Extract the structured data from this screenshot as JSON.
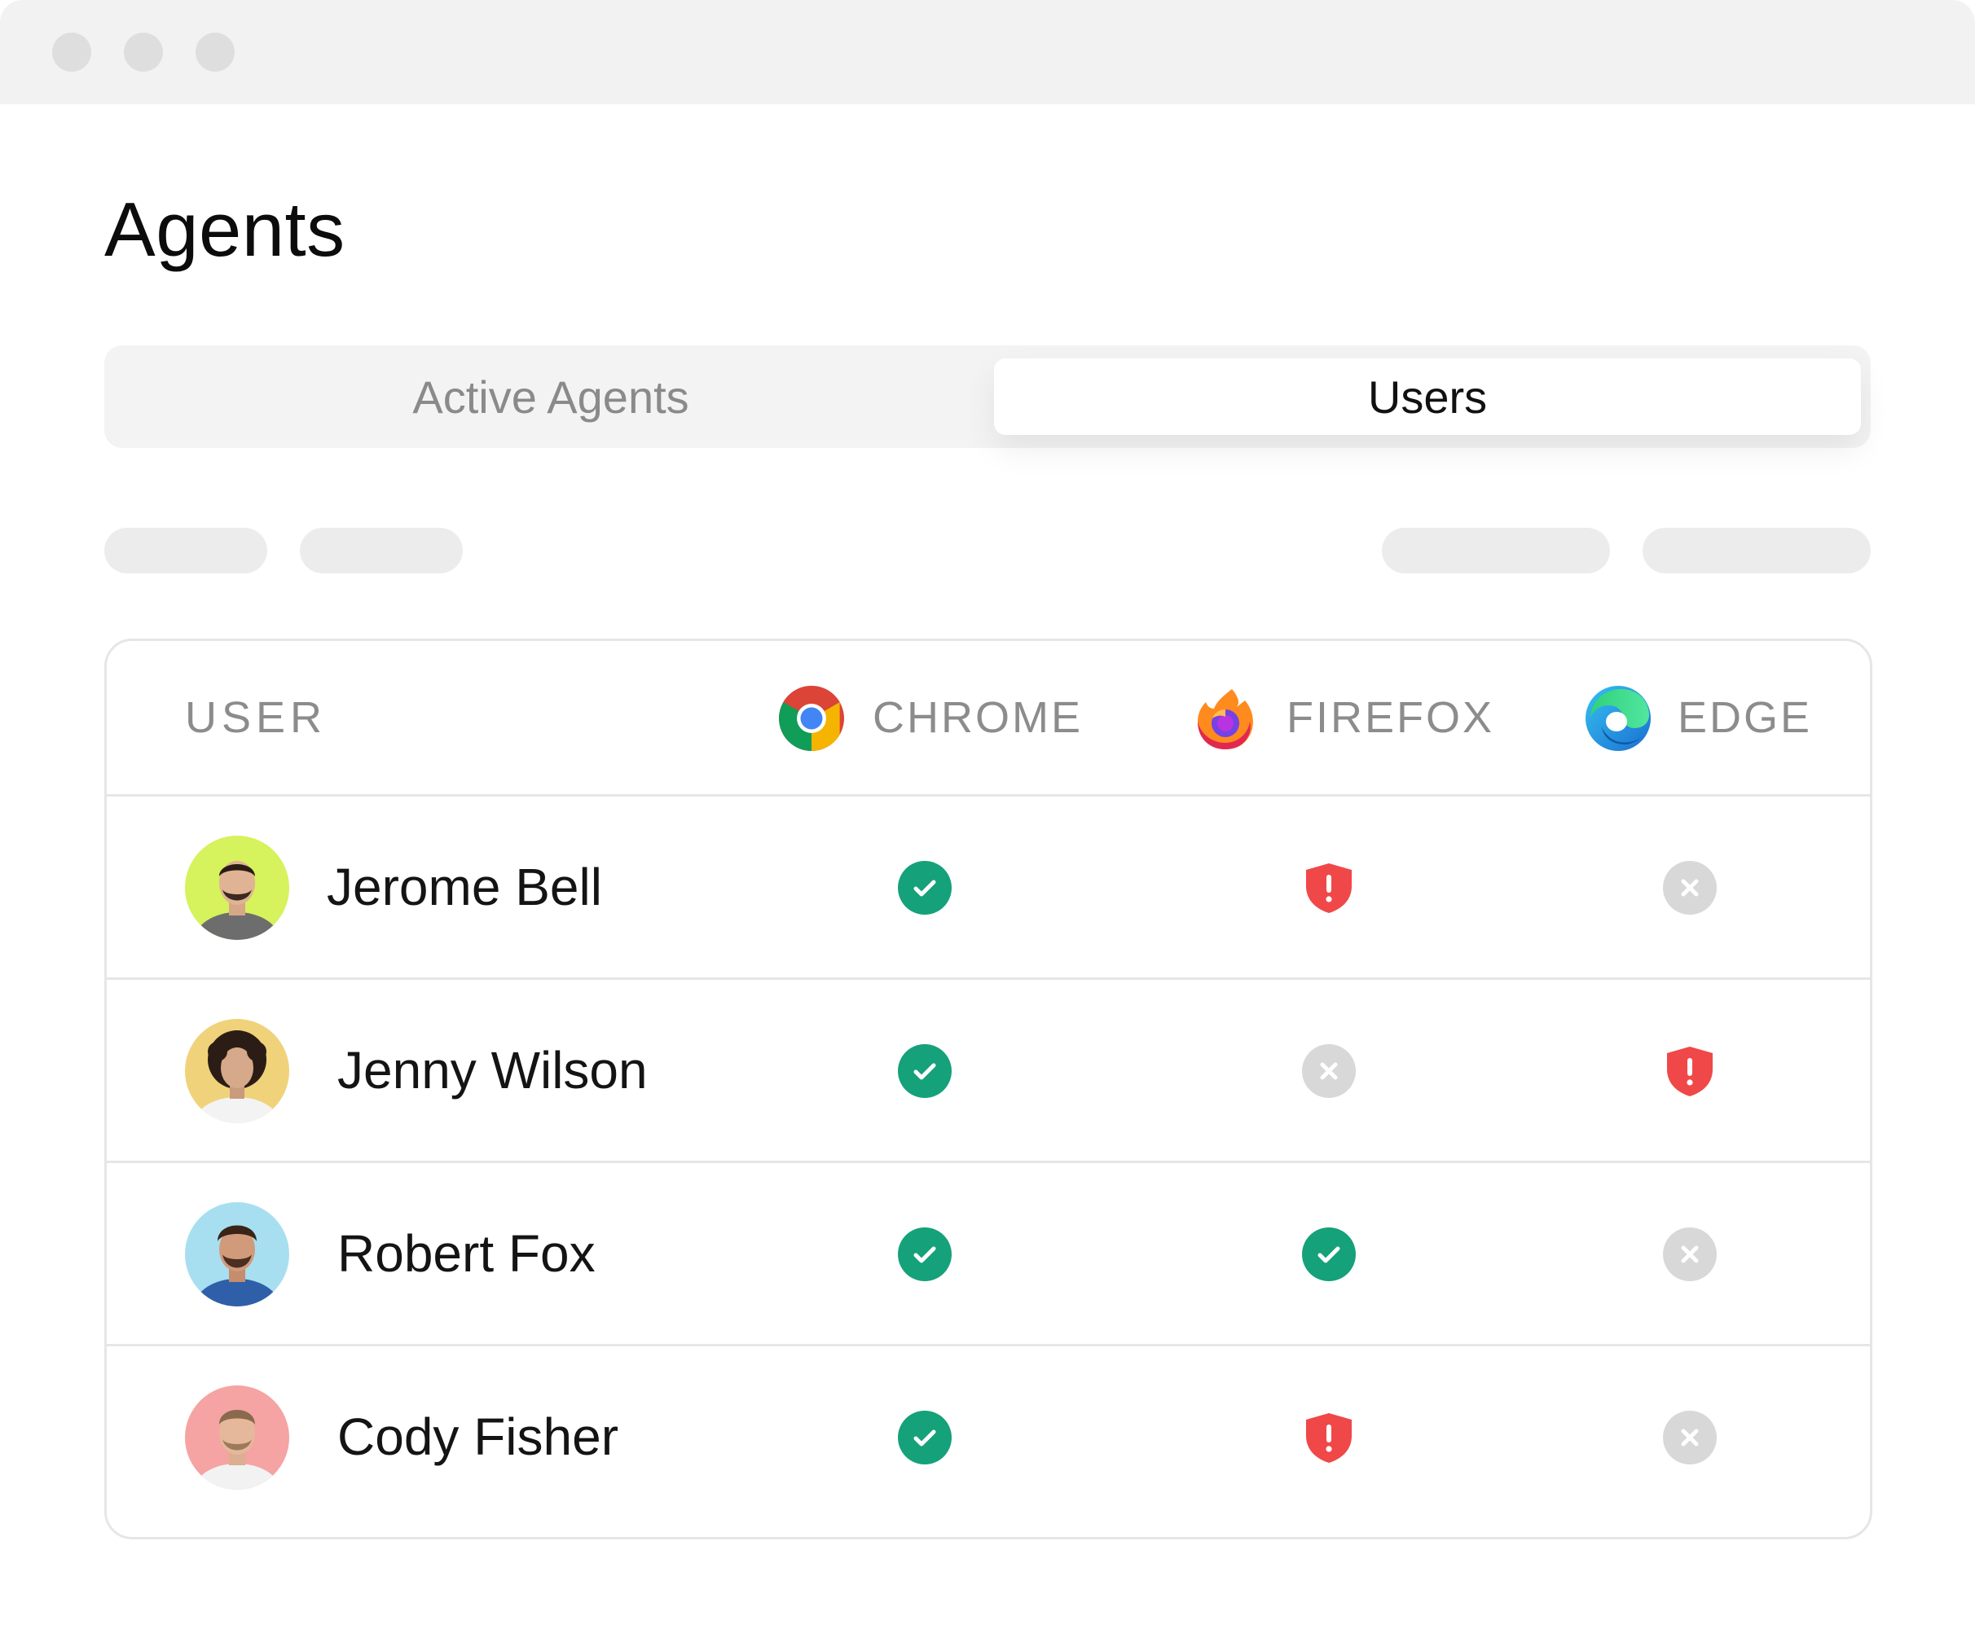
{
  "page": {
    "title": "Agents"
  },
  "tabs": [
    {
      "label": "Active Agents",
      "active": false
    },
    {
      "label": "Users",
      "active": true
    }
  ],
  "table": {
    "columns": {
      "user": "USER",
      "chrome": "CHROME",
      "firefox": "FIREFOX",
      "edge": "EDGE"
    },
    "rows": [
      {
        "name": "Jerome Bell",
        "avatar_bg": "#d6f25c",
        "chrome": "ok",
        "firefox": "alert",
        "edge": "none"
      },
      {
        "name": "Jenny Wilson",
        "avatar_bg": "#f0d27a",
        "chrome": "ok",
        "firefox": "none",
        "edge": "alert"
      },
      {
        "name": "Robert Fox",
        "avatar_bg": "#a8dff0",
        "chrome": "ok",
        "firefox": "ok",
        "edge": "none"
      },
      {
        "name": "Cody Fisher",
        "avatar_bg": "#f5a3a3",
        "chrome": "ok",
        "firefox": "alert",
        "edge": "none"
      }
    ]
  },
  "colors": {
    "ok": "#15a17a",
    "alert": "#f04848",
    "none": "#d8d8d8"
  }
}
